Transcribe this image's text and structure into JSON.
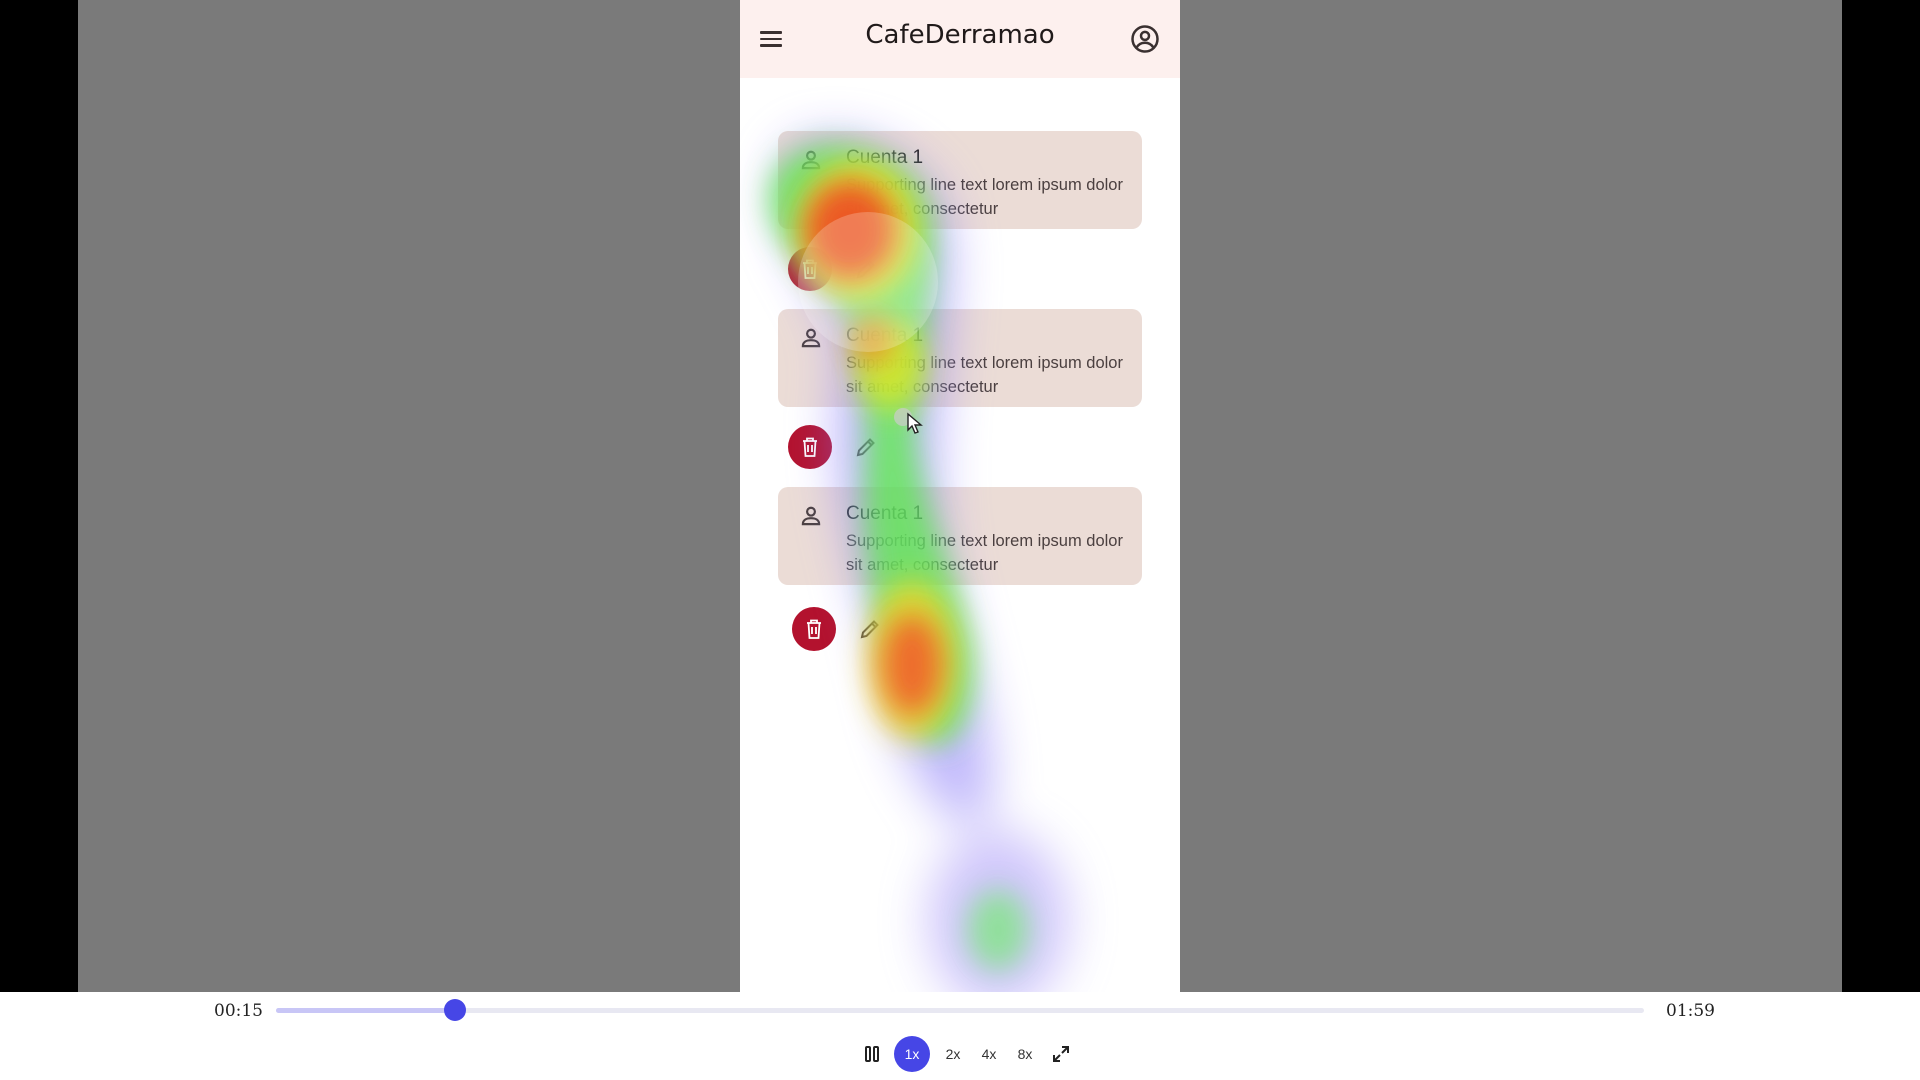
{
  "app": {
    "title": "CafeDerramao",
    "icons": {
      "menu": "menu-icon",
      "account": "account-circle-icon"
    }
  },
  "accounts": [
    {
      "name": "Cuenta 1",
      "supporting": "Supporting line text lorem ipsum dolor sit amet, consectetur"
    },
    {
      "name": "Cuenta 1",
      "supporting": "Supporting line text lorem ipsum dolor sit amet, consectetur"
    },
    {
      "name": "Cuenta 1",
      "supporting": "Supporting line text lorem ipsum dolor sit amet, consectetur"
    }
  ],
  "row_icons": {
    "person": "person-icon",
    "delete": "trash-icon",
    "edit": "pencil-icon"
  },
  "player": {
    "current_time": "00:15",
    "total_time": "01:59",
    "progress": 0.131,
    "state": "playing",
    "speeds": [
      "1x",
      "2x",
      "4x",
      "8x"
    ],
    "active_speed": "1x",
    "icons": {
      "pause": "pause-icon",
      "fullscreen": "fullscreen-icon"
    }
  },
  "colors": {
    "accent": "#4646e6",
    "delete_button": "#b3122e",
    "card_bg": "#ebdcd6",
    "appbar_bg": "#fdf0ee"
  }
}
